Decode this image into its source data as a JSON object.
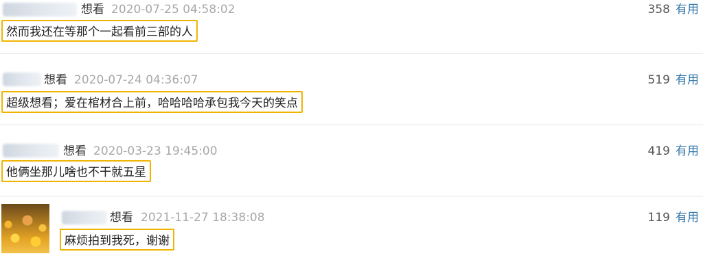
{
  "comments": [
    {
      "status": "想看",
      "time": "2020-07-25 04:58:02",
      "votes": "358",
      "vote_label": "有用",
      "text": "然而我还在等那个一起看前三部的人"
    },
    {
      "status": "想看",
      "time": "2020-07-24 04:36:07",
      "votes": "519",
      "vote_label": "有用",
      "text": "超级想看；爱在棺材合上前，哈哈哈哈承包我今天的笑点"
    },
    {
      "status": "想看",
      "time": "2020-03-23 19:45:00",
      "votes": "419",
      "vote_label": "有用",
      "text": "他俩坐那儿啥也不干就五星"
    },
    {
      "status": "想看",
      "time": "2021-11-27 18:38:08",
      "votes": "119",
      "vote_label": "有用",
      "text": "麻烦拍到我死，谢谢"
    }
  ],
  "colors": {
    "highlight_border": "#f0b400",
    "link": "#3377aa",
    "timestamp": "#a8a8a8"
  }
}
